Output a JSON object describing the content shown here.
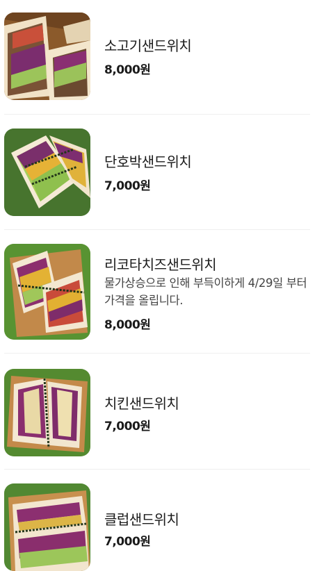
{
  "menu": {
    "items": [
      {
        "name": "소고기샌드위치",
        "description": "",
        "price": "8,000원",
        "photo": "beef-sandwich-photo"
      },
      {
        "name": "단호박샌드위치",
        "description": "",
        "price": "7,000원",
        "photo": "pumpkin-sandwich-photo"
      },
      {
        "name": "리코타치즈샌드위치",
        "description": "물가상승으로 인해 부득이하게 4/29일 부터 가격을 올립니다.",
        "price": "8,000원",
        "photo": "ricotta-sandwich-photo"
      },
      {
        "name": "치킨샌드위치",
        "description": "",
        "price": "7,000원",
        "photo": "chicken-sandwich-photo"
      },
      {
        "name": "클럽샌드위치",
        "description": "",
        "price": "7,000원",
        "photo": "club-sandwich-photo"
      }
    ]
  }
}
